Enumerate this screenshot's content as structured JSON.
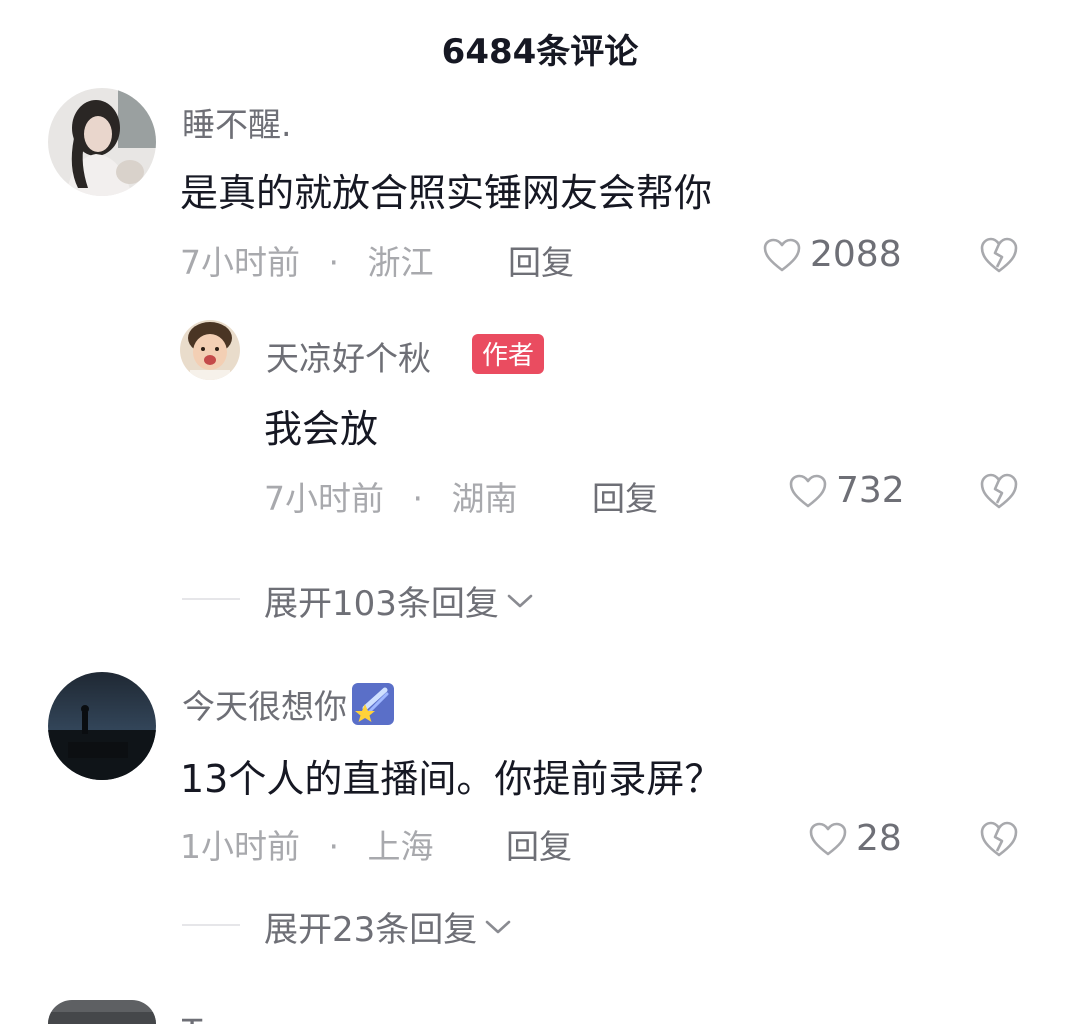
{
  "header": {
    "title": "6484条评论"
  },
  "comments": [
    {
      "username": "睡不醒.",
      "text": "是真的就放合照实锤网友会帮你",
      "time": "7小时前",
      "separator": "·",
      "location": "浙江",
      "reply_label": "回复",
      "likes": "2088",
      "replies": [
        {
          "username": "天凉好个秋",
          "badge": "作者",
          "text": "我会放",
          "time": "7小时前",
          "separator": "·",
          "location": "湖南",
          "reply_label": "回复",
          "likes": "732"
        }
      ],
      "expand_label": "展开103条回复"
    },
    {
      "username": "今天很想你",
      "username_emoji": "shooting-star-emoji",
      "text": "13个人的直播间。你提前录屏？",
      "time": "1小时前",
      "separator": "·",
      "location": "上海",
      "reply_label": "回复",
      "likes": "28",
      "expand_label": "展开23条回复"
    },
    {
      "username": "Tango"
    }
  ],
  "colors": {
    "text_primary": "#161823",
    "text_secondary": "#6e6f76",
    "text_meta": "#a8a9ad",
    "author_badge": "#ea4c60"
  },
  "icons": [
    "heart-outline-icon",
    "broken-heart-icon",
    "chevron-down-icon"
  ]
}
